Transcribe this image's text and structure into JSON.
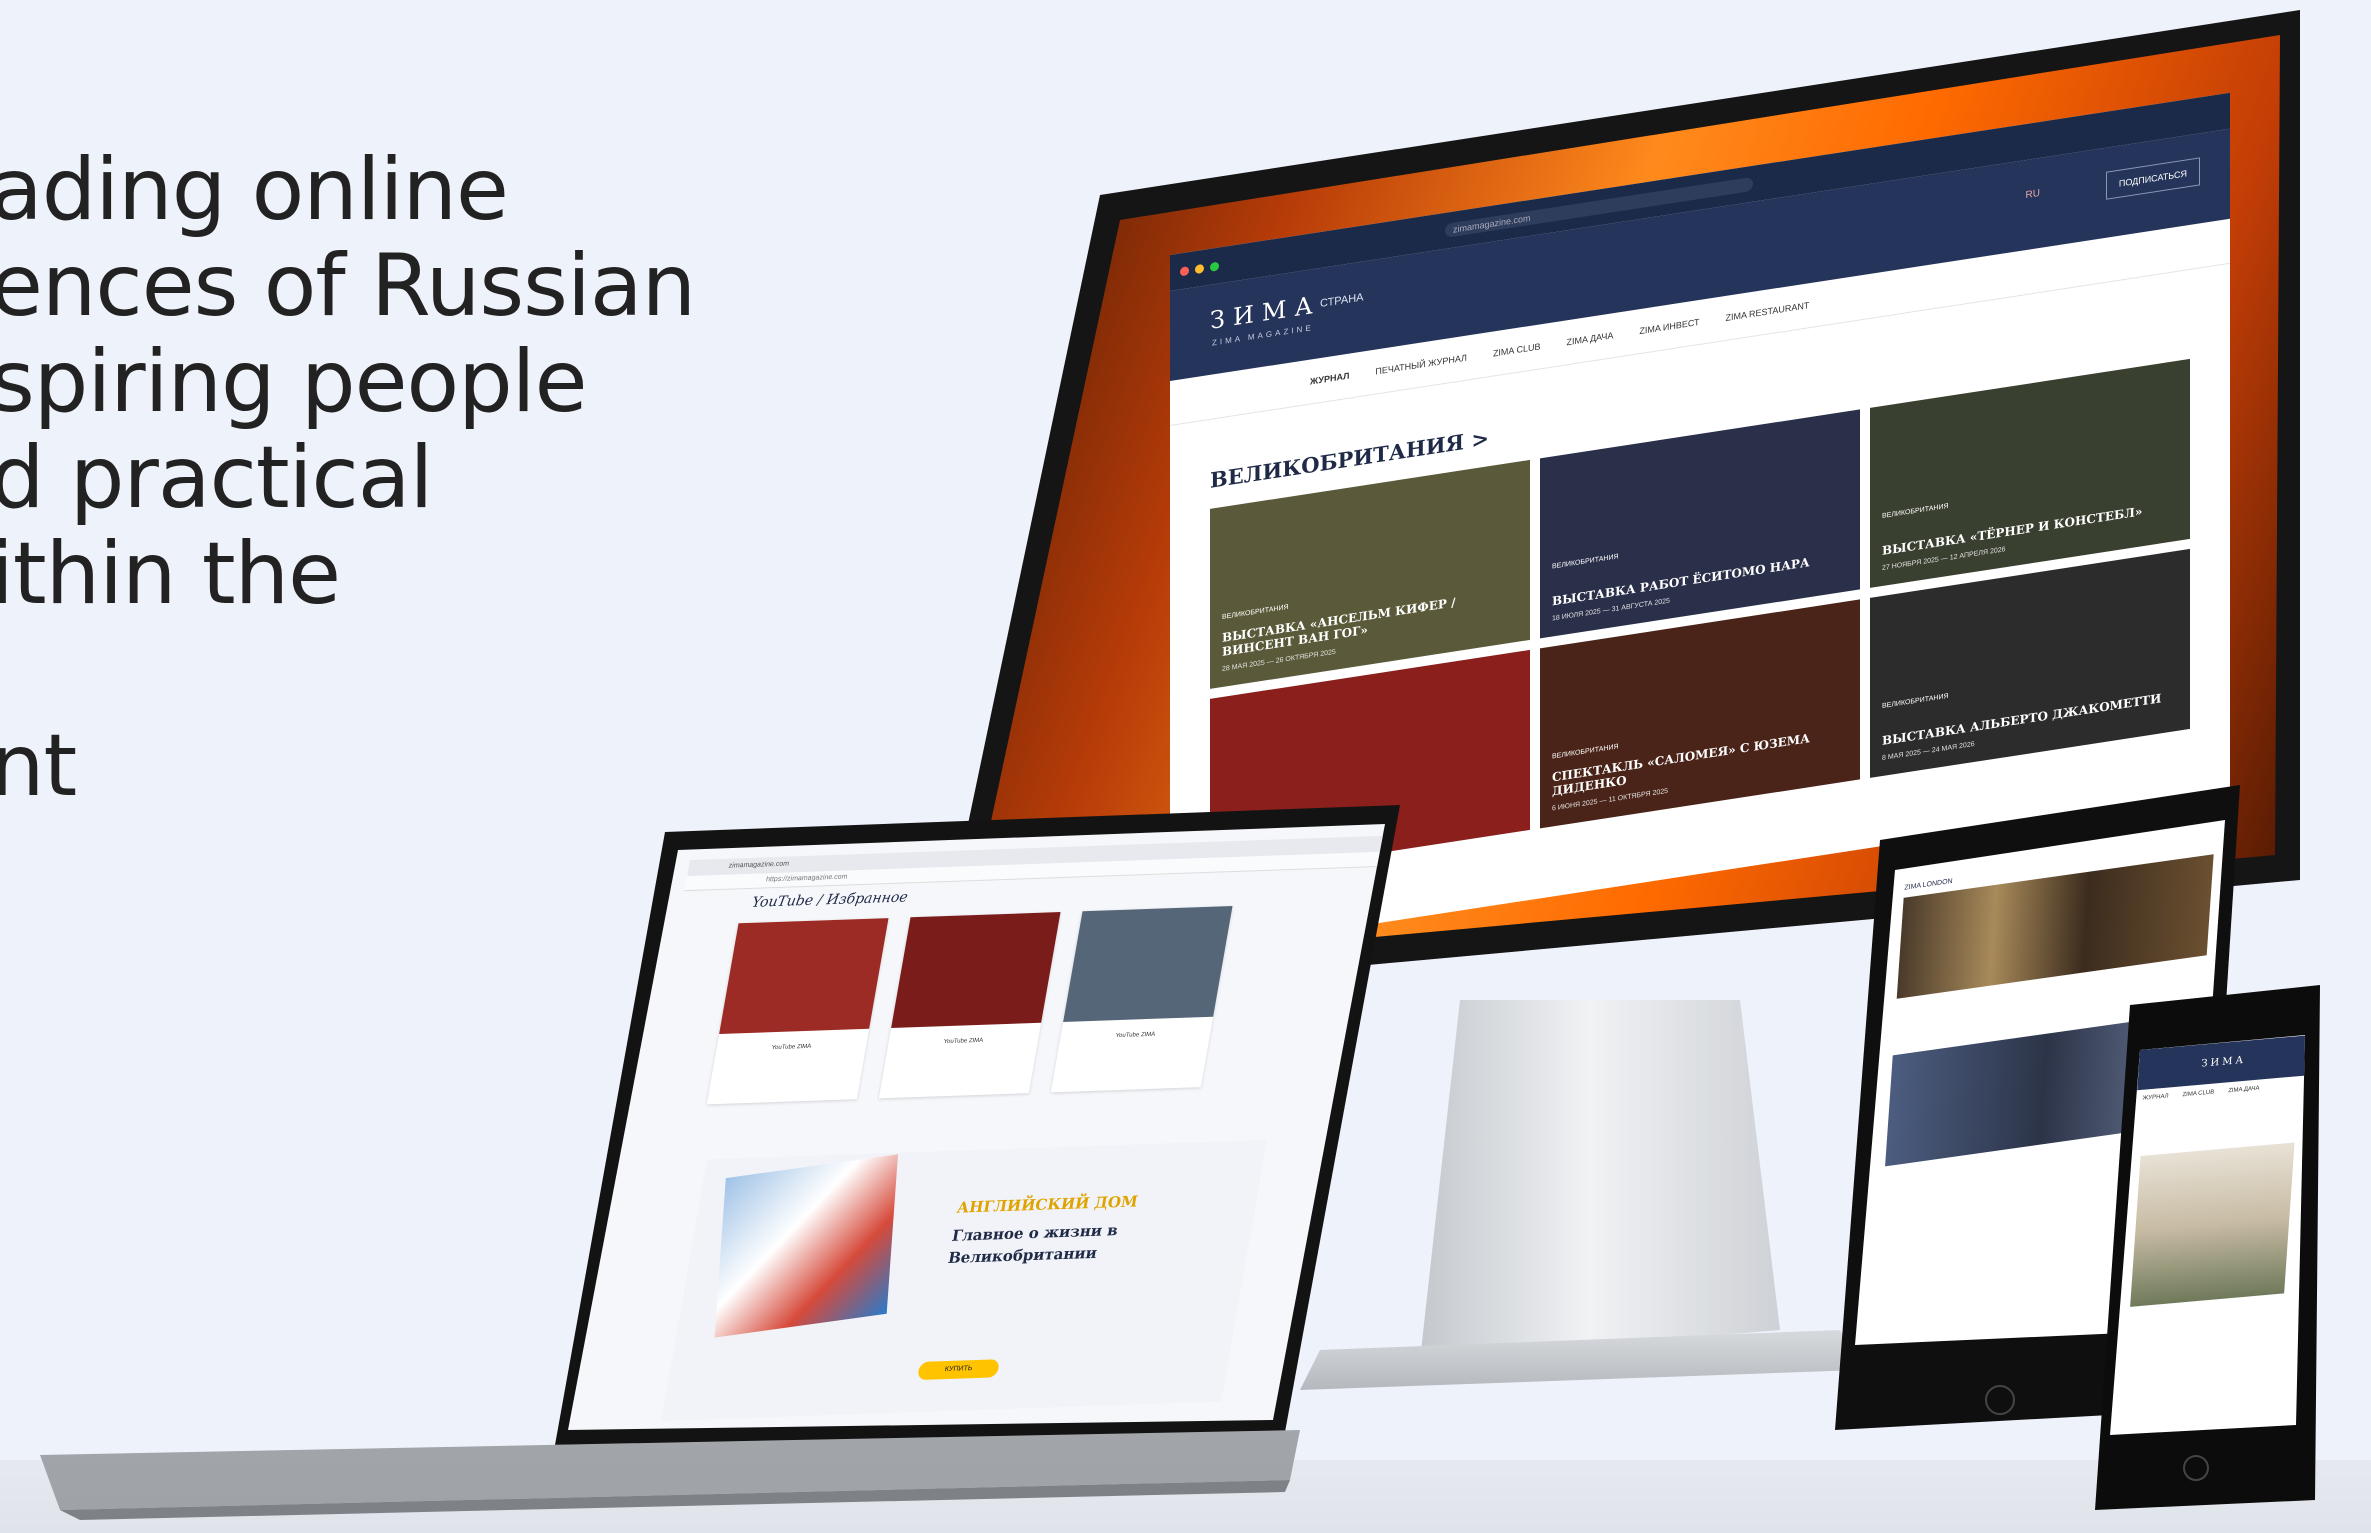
{
  "copy": {
    "lines": [
      "ading online",
      "ences of Russian",
      "spiring people",
      "d practical",
      "ithin the",
      "",
      "nt"
    ]
  },
  "desktop_site": {
    "logo": "ЗИМА",
    "logo_sub": "ZIMA MAGAZINE",
    "country_selector": "СТРАНА",
    "language": "RU",
    "subscribe_label": "ПОДПИСАТЬСЯ",
    "url": "zimamagazine.com",
    "nav": [
      "ЖУРНАЛ",
      "ПЕЧАТНЫЙ ЖУРНАЛ",
      "ZIMA CLUB",
      "ZIMA ДАЧА",
      "ZIMA ИНВЕСТ",
      "ZIMA RESTAURANT"
    ],
    "section_title": "ВЕЛИКОБРИТАНИЯ >",
    "cards": [
      {
        "tag": "ВЕЛИКОБРИТАНИЯ",
        "title": "ВЫСТАВКА «АНСЕЛЬМ КИФЕР / ВИНСЕНТ ВАН ГОГ»",
        "date": "28 МАЯ 2025 — 26 ОКТЯБРЯ 2025",
        "color": "#5a5a3a"
      },
      {
        "tag": "ВЕЛИКОБРИТАНИЯ",
        "title": "ВЫСТАВКА РАБОТ ЁСИТОМО НАРА",
        "date": "18 ИЮЛЯ 2025 — 31 АВГУСТА 2025",
        "color": "#2a2f4a"
      },
      {
        "tag": "ВЕЛИКОБРИТАНИЯ",
        "title": "ВЫСТАВКА «ТЁРНЕР И КОНСТЕБЛ»",
        "date": "27 НОЯБРЯ 2025 — 12 АПРЕЛЯ 2026",
        "color": "#3a4030"
      },
      {
        "tag": "",
        "title": "",
        "date": "",
        "color": "#8a1f1c"
      },
      {
        "tag": "ВЕЛИКОБРИТАНИЯ",
        "title": "СПЕКТАКЛЬ «САЛОМЕЯ» С ЮЗЕМА ДИДЕНКО",
        "date": "6 ИЮНЯ 2025 — 11 ОКТЯБРЯ 2025",
        "color": "#4a2418"
      },
      {
        "tag": "ВЕЛИКОБРИТАНИЯ",
        "title": "ВЫСТАВКА АЛЬБЕРТО ДЖАКОМЕТТИ",
        "date": "8 МАЯ 2025 — 24 МАЯ 2026",
        "color": "#2c2c2c"
      }
    ]
  },
  "laptop_site": {
    "tab_title": "zimamagazine.com",
    "url": "https://zimamagazine.com",
    "youtube_title": "YouTube / Избранное",
    "videos": [
      {
        "caption": "YouTube ZIMA",
        "color": "#9b2b24"
      },
      {
        "caption": "YouTube ZIMA",
        "color": "#7a1d1a"
      },
      {
        "caption": "YouTube ZIMA",
        "color": "#556678"
      }
    ],
    "promo_kicker": "АНГЛИЙСКИЙ ДОМ",
    "promo_title": "Главное о жизни в Великобритании",
    "promo_button": "КУПИТЬ"
  },
  "tablet_site": {
    "header": "ZIMA LONDON"
  },
  "phone_site": {
    "logo": "ЗИМА",
    "nav": [
      "ЖУРНАЛ",
      "ZIMA CLUB",
      "ZIMA ДАЧА"
    ]
  },
  "colors": {
    "background": "#eef2fb",
    "brand_navy": "#25345a",
    "accent_yellow": "#ffc300"
  }
}
